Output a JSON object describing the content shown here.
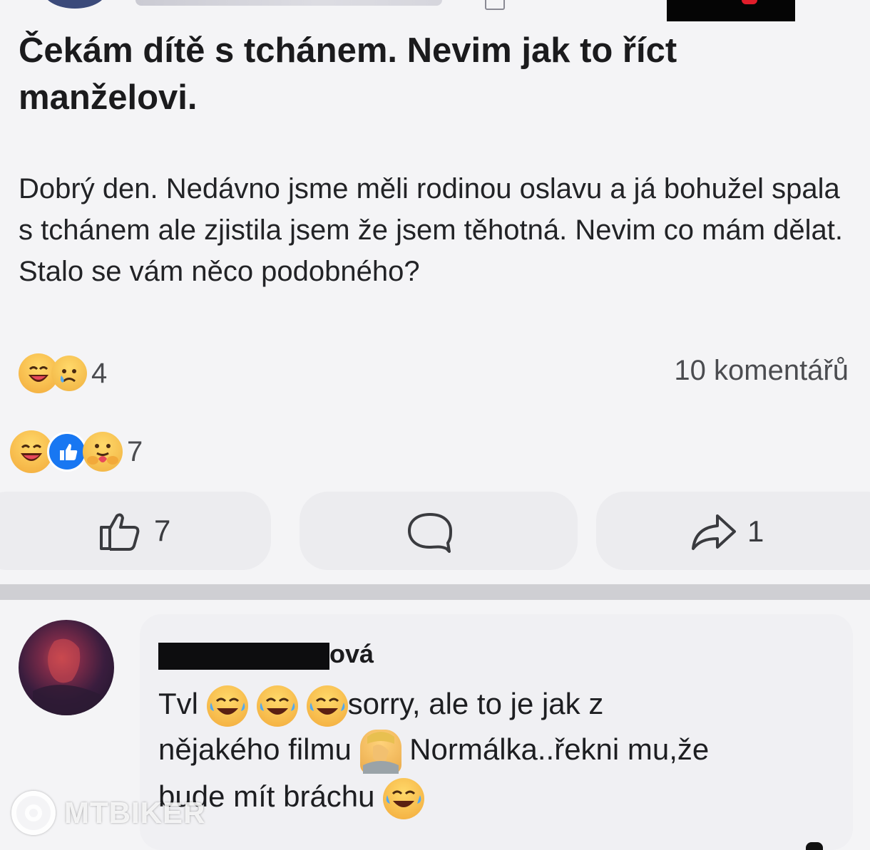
{
  "post": {
    "title": "Čekám dítě s tchánem. Nevim jak to říct manželovi.",
    "body": "Dobrý den. Nedávno jsme měli rodinou oslavu a já bohužel spala s tchánem ale zjistila jsem že jsem těhotná. Nevim co mám dělat. Stalo se vám něco podobného?",
    "reactions_1": {
      "icons": [
        "laugh-emoji",
        "sad-emoji"
      ],
      "count": "4"
    },
    "comments_count": "10 komentářů",
    "reactions_2": {
      "icons": [
        "laugh-emoji",
        "like-emoji",
        "care-emoji"
      ],
      "count": "7"
    }
  },
  "actions": {
    "like_count": "7",
    "share_count": "1",
    "icons": [
      "thumbs-up-icon",
      "comment-icon",
      "share-icon"
    ]
  },
  "comment": {
    "name_visible_tail": "ová",
    "lines": [
      {
        "before": "Tvl ",
        "emojis": [
          "tears-of-joy-emoji",
          "tears-of-joy-emoji",
          "tears-of-joy-emoji"
        ],
        "after": "sorry, ale to je jak z"
      },
      {
        "before": "nějakého filmu ",
        "emojis": [
          "facepalm-emoji"
        ],
        "after": " Normálka..řekni mu,že"
      },
      {
        "before": "bude mít bráchu ",
        "emojis": [
          "tears-of-joy-emoji"
        ],
        "after": ""
      }
    ]
  },
  "watermark": {
    "text": "MTBIKER"
  },
  "colors": {
    "like_blue": "#1877f2",
    "emoji_yellow": "#f7c136",
    "redaction": "#0d0d0f",
    "background": "#f4f4f6"
  }
}
